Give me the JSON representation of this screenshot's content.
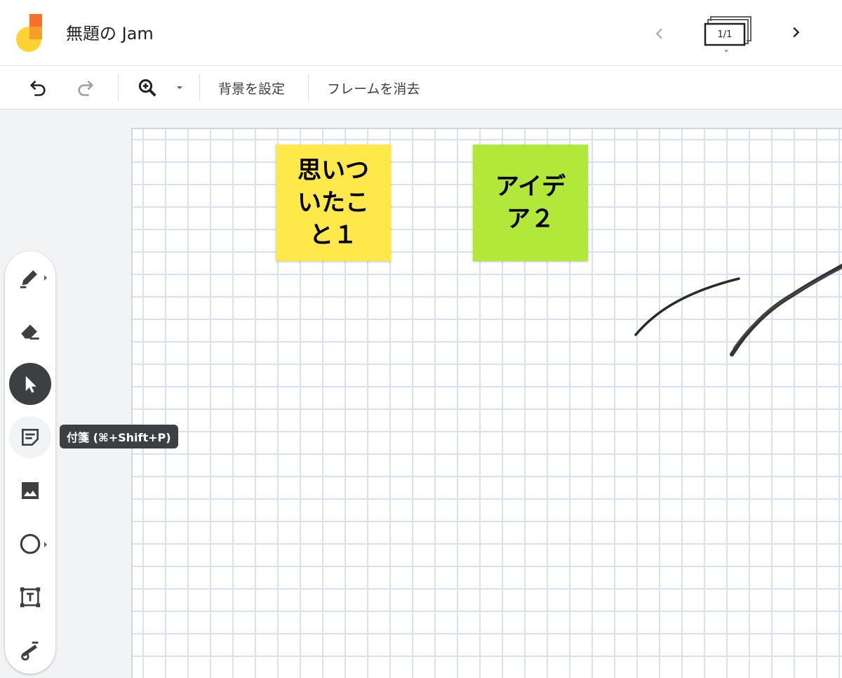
{
  "app": {
    "title": "無題の Jam",
    "logo_icon": "jamboard-logo-icon"
  },
  "frames": {
    "counter": "1/1",
    "prev_icon": "chevron-left-icon",
    "next_icon": "chevron-right-icon"
  },
  "toolbar": {
    "undo_icon": "undo-icon",
    "redo_icon": "redo-icon",
    "zoom_icon": "zoom-in-icon",
    "set_background": "背景を設定",
    "clear_frame": "フレームを消去"
  },
  "notes": [
    {
      "text": "思いついたこと１",
      "color": "#ffe84a"
    },
    {
      "text": "アイデア２",
      "color": "#b2e83a"
    }
  ],
  "tools": [
    {
      "name": "pen",
      "icon": "pen-icon"
    },
    {
      "name": "eraser",
      "icon": "eraser-icon"
    },
    {
      "name": "select",
      "icon": "select-cursor-icon",
      "active": true
    },
    {
      "name": "sticky-note",
      "icon": "sticky-note-icon"
    },
    {
      "name": "image",
      "icon": "image-icon"
    },
    {
      "name": "circle",
      "icon": "circle-shape-icon"
    },
    {
      "name": "text-box",
      "icon": "text-box-icon"
    },
    {
      "name": "laser",
      "icon": "laser-icon"
    }
  ],
  "tooltip": {
    "text": "付箋 (⌘+Shift+P)"
  },
  "colors": {
    "active_tool": "#3c4043",
    "grid_line": "#d6e2f3",
    "workspace_bg": "#f1f3f4"
  }
}
